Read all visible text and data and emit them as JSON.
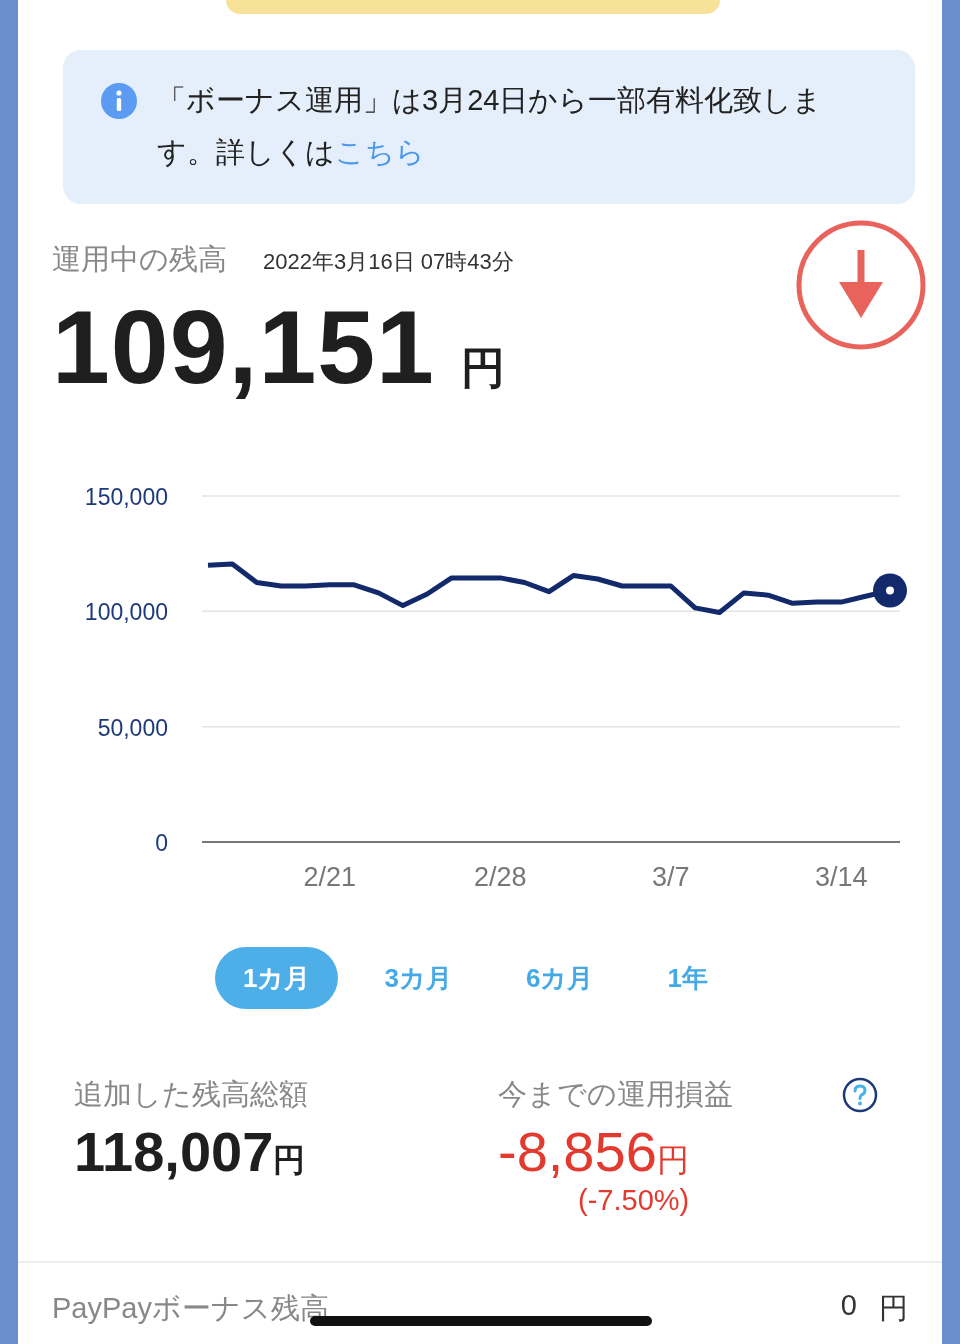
{
  "notice": {
    "text": "「ボーナス運用」は3月24日から一部有料化致します。詳しくは",
    "link": "こちら"
  },
  "balance": {
    "label": "運用中の残高",
    "timestamp": "2022年3月16日 07時43分",
    "amount": "109,151",
    "unit": "円"
  },
  "chart_data": {
    "type": "line",
    "categories": [
      null,
      null,
      null,
      null,
      null,
      "2/21",
      null,
      null,
      null,
      null,
      null,
      null,
      "2/28",
      null,
      null,
      null,
      null,
      null,
      null,
      "3/7",
      null,
      null,
      null,
      null,
      null,
      null,
      "3/14",
      null,
      null
    ],
    "series": [
      {
        "color": "#12296b",
        "values": [
          120000,
          120500,
          112500,
          111000,
          111000,
          111500,
          111500,
          108000,
          102500,
          107500,
          114500,
          114500,
          114500,
          112500,
          108500,
          115500,
          114000,
          111000,
          111000,
          111000,
          101500,
          99500,
          108000,
          107000,
          103500,
          104000,
          104000,
          106500,
          109000
        ]
      }
    ],
    "ylim": [
      0,
      150000
    ],
    "yticks": [
      {
        "value": 0,
        "label": "0"
      },
      {
        "value": 50000,
        "label": "50,000"
      },
      {
        "value": 100000,
        "label": "100,000"
      },
      {
        "value": 150000,
        "label": "150,000"
      }
    ]
  },
  "periods": [
    {
      "label": "1カ月",
      "selected": true
    },
    {
      "label": "3カ月",
      "selected": false
    },
    {
      "label": "6カ月",
      "selected": false
    },
    {
      "label": "1年",
      "selected": false
    }
  ],
  "summary": {
    "added": {
      "label": "追加した残高総額",
      "amount": "118,007",
      "unit": "円"
    },
    "profit": {
      "label": "今までの運用損益",
      "amount": "-8,856",
      "unit": "円",
      "percent": "(-7.50%)"
    }
  },
  "bonus_row": {
    "label": "PayPayボーナス残高",
    "amount": "0",
    "unit": "円"
  }
}
